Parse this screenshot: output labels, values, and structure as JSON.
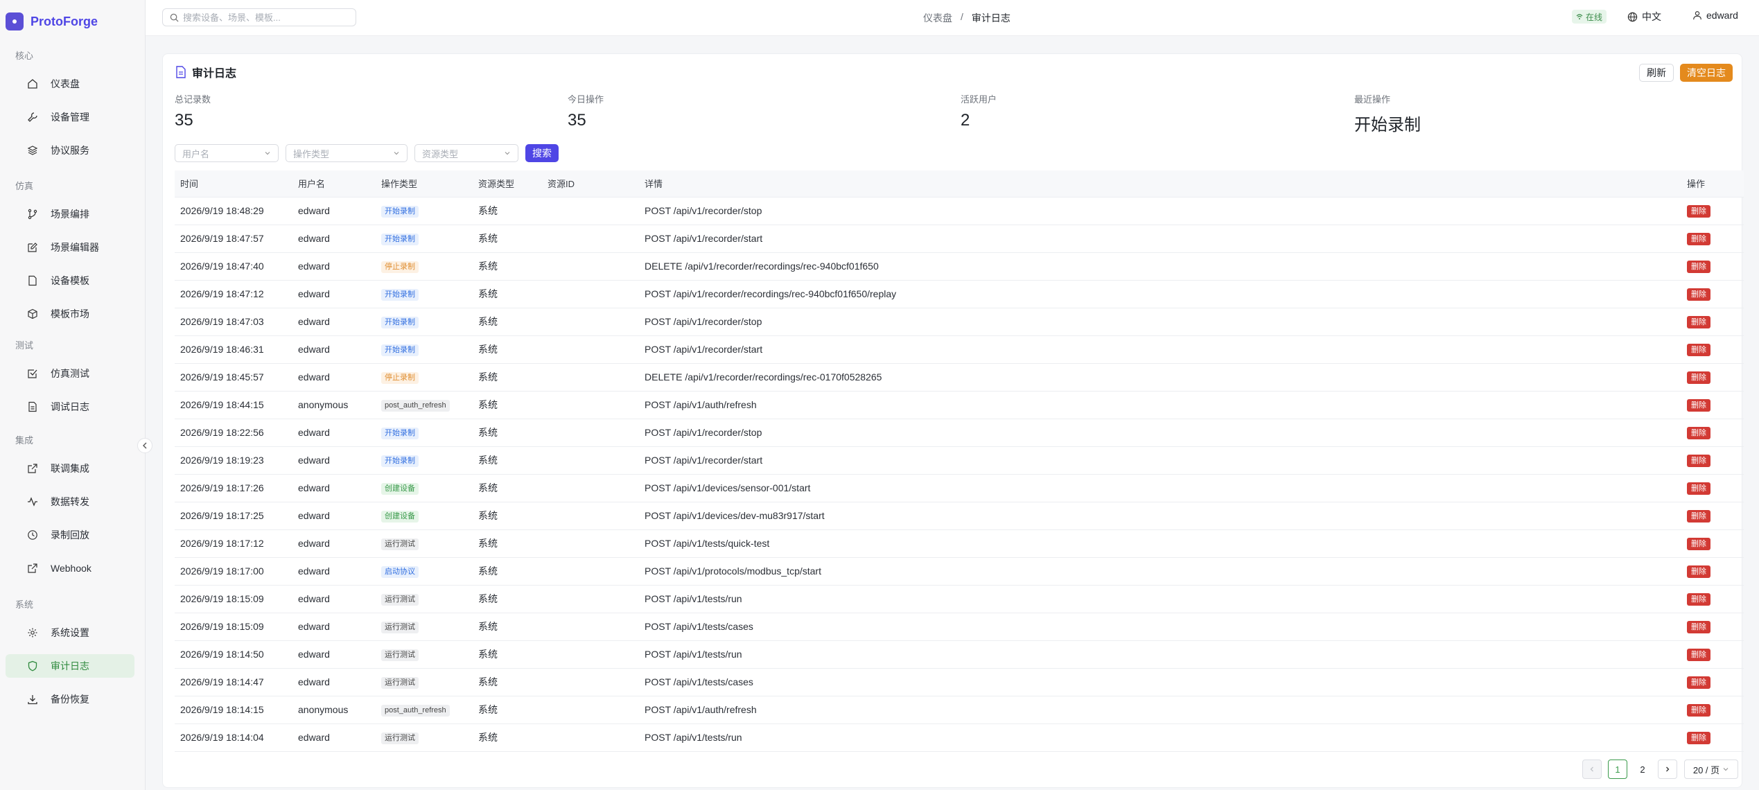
{
  "brand": {
    "name": "ProtoForge"
  },
  "sidebar": {
    "groups": [
      {
        "label": "核心",
        "items": [
          {
            "label": "仪表盘",
            "icon": "home-icon"
          },
          {
            "label": "设备管理",
            "icon": "wrench-icon"
          },
          {
            "label": "协议服务",
            "icon": "layers-icon"
          }
        ]
      },
      {
        "label": "仿真",
        "items": [
          {
            "label": "场景编排",
            "icon": "git-branch-icon"
          },
          {
            "label": "场景编辑器",
            "icon": "edit-icon"
          },
          {
            "label": "设备模板",
            "icon": "file-icon"
          },
          {
            "label": "模板市场",
            "icon": "box-icon"
          }
        ]
      },
      {
        "label": "测试",
        "items": [
          {
            "label": "仿真测试",
            "icon": "check-square-icon"
          },
          {
            "label": "调试日志",
            "icon": "file-text-icon"
          }
        ]
      },
      {
        "label": "集成",
        "items": [
          {
            "label": "联调集成",
            "icon": "external-link-icon"
          },
          {
            "label": "数据转发",
            "icon": "activity-icon"
          },
          {
            "label": "录制回放",
            "icon": "clock-icon"
          },
          {
            "label": "Webhook",
            "icon": "external-link-icon"
          }
        ]
      },
      {
        "label": "系统",
        "items": [
          {
            "label": "系统设置",
            "icon": "gear-icon"
          },
          {
            "label": "审计日志",
            "icon": "shield-icon",
            "active": true
          },
          {
            "label": "备份恢复",
            "icon": "download-icon"
          }
        ]
      }
    ]
  },
  "topbar": {
    "search_placeholder": "搜索设备、场景、模板...",
    "breadcrumb": [
      "仪表盘",
      "审计日志"
    ],
    "breadcrumb_sep": "/",
    "status": "在线",
    "language": "中文",
    "username": "edward"
  },
  "page": {
    "title": "审计日志",
    "refresh_label": "刷新",
    "clear_label": "清空日志",
    "stats": [
      {
        "label": "总记录数",
        "value": "35"
      },
      {
        "label": "今日操作",
        "value": "35"
      },
      {
        "label": "活跃用户",
        "value": "2"
      },
      {
        "label": "最近操作",
        "value": "开始录制"
      }
    ],
    "filters": {
      "user_placeholder": "用户名",
      "action_placeholder": "操作类型",
      "resource_placeholder": "资源类型",
      "search_label": "搜索"
    },
    "table": {
      "headers": [
        "时间",
        "用户名",
        "操作类型",
        "资源类型",
        "资源ID",
        "详情",
        "操作"
      ],
      "delete_label": "删除",
      "rows": [
        {
          "time": "2026/9/19 18:48:29",
          "user": "edward",
          "action": "开始录制",
          "tag": "blue",
          "resource": "系统",
          "rid": "",
          "detail": "POST /api/v1/recorder/stop"
        },
        {
          "time": "2026/9/19 18:47:57",
          "user": "edward",
          "action": "开始录制",
          "tag": "blue",
          "resource": "系统",
          "rid": "",
          "detail": "POST /api/v1/recorder/start"
        },
        {
          "time": "2026/9/19 18:47:40",
          "user": "edward",
          "action": "停止录制",
          "tag": "orange",
          "resource": "系统",
          "rid": "",
          "detail": "DELETE /api/v1/recorder/recordings/rec-940bcf01f650"
        },
        {
          "time": "2026/9/19 18:47:12",
          "user": "edward",
          "action": "开始录制",
          "tag": "blue",
          "resource": "系统",
          "rid": "",
          "detail": "POST /api/v1/recorder/recordings/rec-940bcf01f650/replay"
        },
        {
          "time": "2026/9/19 18:47:03",
          "user": "edward",
          "action": "开始录制",
          "tag": "blue",
          "resource": "系统",
          "rid": "",
          "detail": "POST /api/v1/recorder/stop"
        },
        {
          "time": "2026/9/19 18:46:31",
          "user": "edward",
          "action": "开始录制",
          "tag": "blue",
          "resource": "系统",
          "rid": "",
          "detail": "POST /api/v1/recorder/start"
        },
        {
          "time": "2026/9/19 18:45:57",
          "user": "edward",
          "action": "停止录制",
          "tag": "orange",
          "resource": "系统",
          "rid": "",
          "detail": "DELETE /api/v1/recorder/recordings/rec-0170f0528265"
        },
        {
          "time": "2026/9/19 18:44:15",
          "user": "anonymous",
          "action": "post_auth_refresh",
          "tag": "gray",
          "resource": "系统",
          "rid": "",
          "detail": "POST /api/v1/auth/refresh"
        },
        {
          "time": "2026/9/19 18:22:56",
          "user": "edward",
          "action": "开始录制",
          "tag": "blue",
          "resource": "系统",
          "rid": "",
          "detail": "POST /api/v1/recorder/stop"
        },
        {
          "time": "2026/9/19 18:19:23",
          "user": "edward",
          "action": "开始录制",
          "tag": "blue",
          "resource": "系统",
          "rid": "",
          "detail": "POST /api/v1/recorder/start"
        },
        {
          "time": "2026/9/19 18:17:26",
          "user": "edward",
          "action": "创建设备",
          "tag": "green",
          "resource": "系统",
          "rid": "",
          "detail": "POST /api/v1/devices/sensor-001/start"
        },
        {
          "time": "2026/9/19 18:17:25",
          "user": "edward",
          "action": "创建设备",
          "tag": "green",
          "resource": "系统",
          "rid": "",
          "detail": "POST /api/v1/devices/dev-mu83r917/start"
        },
        {
          "time": "2026/9/19 18:17:12",
          "user": "edward",
          "action": "运行测试",
          "tag": "gray",
          "resource": "系统",
          "rid": "",
          "detail": "POST /api/v1/tests/quick-test"
        },
        {
          "time": "2026/9/19 18:17:00",
          "user": "edward",
          "action": "启动协议",
          "tag": "blue",
          "resource": "系统",
          "rid": "",
          "detail": "POST /api/v1/protocols/modbus_tcp/start"
        },
        {
          "time": "2026/9/19 18:15:09",
          "user": "edward",
          "action": "运行测试",
          "tag": "gray",
          "resource": "系统",
          "rid": "",
          "detail": "POST /api/v1/tests/run"
        },
        {
          "time": "2026/9/19 18:15:09",
          "user": "edward",
          "action": "运行测试",
          "tag": "gray",
          "resource": "系统",
          "rid": "",
          "detail": "POST /api/v1/tests/cases"
        },
        {
          "time": "2026/9/19 18:14:50",
          "user": "edward",
          "action": "运行测试",
          "tag": "gray",
          "resource": "系统",
          "rid": "",
          "detail": "POST /api/v1/tests/run"
        },
        {
          "time": "2026/9/19 18:14:47",
          "user": "edward",
          "action": "运行测试",
          "tag": "gray",
          "resource": "系统",
          "rid": "",
          "detail": "POST /api/v1/tests/cases"
        },
        {
          "time": "2026/9/19 18:14:15",
          "user": "anonymous",
          "action": "post_auth_refresh",
          "tag": "gray",
          "resource": "系统",
          "rid": "",
          "detail": "POST /api/v1/auth/refresh"
        },
        {
          "time": "2026/9/19 18:14:04",
          "user": "edward",
          "action": "运行测试",
          "tag": "gray",
          "resource": "系统",
          "rid": "",
          "detail": "POST /api/v1/tests/run"
        }
      ]
    },
    "pagination": {
      "pages": [
        "1",
        "2"
      ],
      "current": "1",
      "page_size": "20 / 页"
    }
  }
}
